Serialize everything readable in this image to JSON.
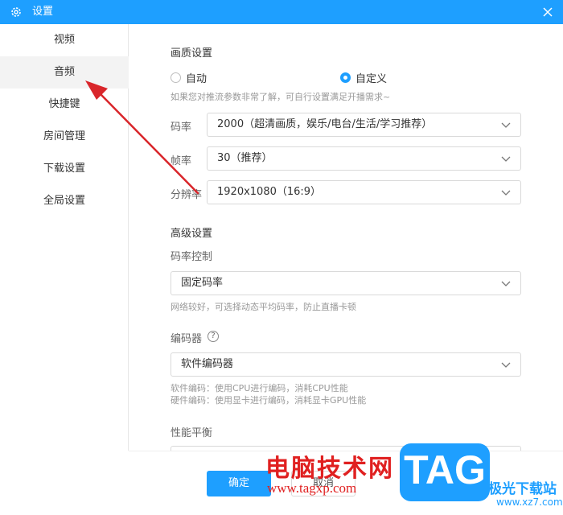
{
  "window": {
    "title": "设置",
    "accent": "#1e9fff"
  },
  "sidebar": {
    "items": [
      {
        "label": "视频"
      },
      {
        "label": "音频"
      },
      {
        "label": "快捷键"
      },
      {
        "label": "房间管理"
      },
      {
        "label": "下载设置"
      },
      {
        "label": "全局设置"
      }
    ],
    "selected": "音频"
  },
  "quality": {
    "title": "画质设置",
    "mode_auto": "自动",
    "mode_custom": "自定义",
    "selected_mode": "自定义",
    "hint": "如果您对推流参数非常了解，可自行设置满足开播需求~",
    "bitrate_label": "码率",
    "bitrate_value": "2000（超清画质，娱乐/电台/生活/学习推荐）",
    "framerate_label": "帧率",
    "framerate_value": "30（推荐）",
    "resolution_label": "分辨率",
    "resolution_value": "1920x1080（16:9）"
  },
  "advanced": {
    "title": "高级设置",
    "rate_control_label": "码率控制",
    "rate_control_value": "固定码率",
    "rate_control_hint": "网络较好，可选择动态平均码率，防止直播卡顿",
    "encoder_label": "编码器",
    "encoder_value": "软件编码器",
    "encoder_hint_1": "软件编码：使用CPU进行编码，消耗CPU性能",
    "encoder_hint_2": "硬件编码：使用显卡进行编码，消耗显卡GPU性能",
    "perf_label": "性能平衡"
  },
  "buttons": {
    "ok": "确定",
    "cancel": "取消"
  },
  "watermark": {
    "text": "电脑技术网",
    "url": "www.tagxp.com",
    "logo": "TAG",
    "cn": "极光下载站",
    "site": "www.xz7.com"
  },
  "annotation": {
    "color": "#d9262b"
  }
}
